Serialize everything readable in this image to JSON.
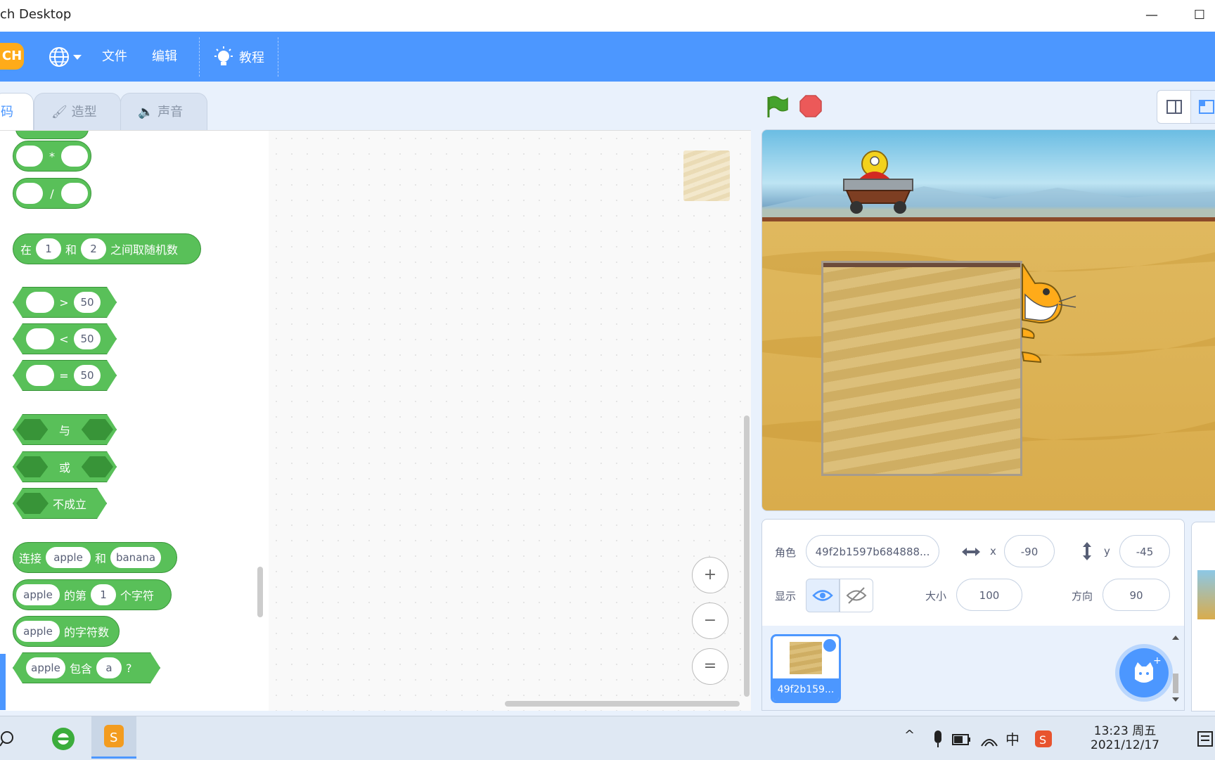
{
  "window": {
    "title": "ch Desktop",
    "minimize_glyph": "—",
    "maximize_glyph": "☐"
  },
  "menu": {
    "logo_text": "CH",
    "language_icon": "globe-icon",
    "file": "文件",
    "edit": "编辑",
    "tutorials": "教程"
  },
  "tabs": [
    {
      "label": "码",
      "active": true
    },
    {
      "label": "造型"
    },
    {
      "label": "声音"
    }
  ],
  "palette": {
    "multiply_op": "*",
    "divide_op": "/",
    "random": {
      "prefix": "在",
      "from": "1",
      "mid": "和",
      "to": "2",
      "suffix": "之间取随机数"
    },
    "gt": {
      "op": ">",
      "value": "50"
    },
    "lt": {
      "op": "<",
      "value": "50"
    },
    "eq": {
      "op": "=",
      "value": "50"
    },
    "and_label": "与",
    "or_label": "或",
    "not_label": "不成立",
    "join": {
      "prefix": "连接",
      "a": "apple",
      "mid": "和",
      "b": "banana"
    },
    "letter_of": {
      "a": "apple",
      "mid": "的第",
      "n": "1",
      "suffix": "个字符"
    },
    "length_of": {
      "a": "apple",
      "suffix": "的字符数"
    },
    "contains": {
      "a": "apple",
      "mid": "包含",
      "b": "a",
      "suffix": "?"
    }
  },
  "script_area": {
    "zoom_in": "+",
    "zoom_out": "−",
    "zoom_reset": "="
  },
  "sprite_info": {
    "sprite_label": "角色",
    "sprite_name": "49f2b1597b684888...",
    "x_label": "x",
    "x_value": "-90",
    "y_label": "y",
    "y_value": "-45",
    "show_label": "显示",
    "size_label": "大小",
    "size_value": "100",
    "direction_label": "方向",
    "direction_value": "90"
  },
  "sprite_list": {
    "thumb_label": "49f2b159..."
  },
  "taskbar": {
    "ime": "中",
    "time": "13:23 周五",
    "date": "2021/12/17"
  },
  "colors": {
    "menu_blue": "#4c97ff",
    "operator_green": "#59c059",
    "operator_border": "#389438"
  }
}
